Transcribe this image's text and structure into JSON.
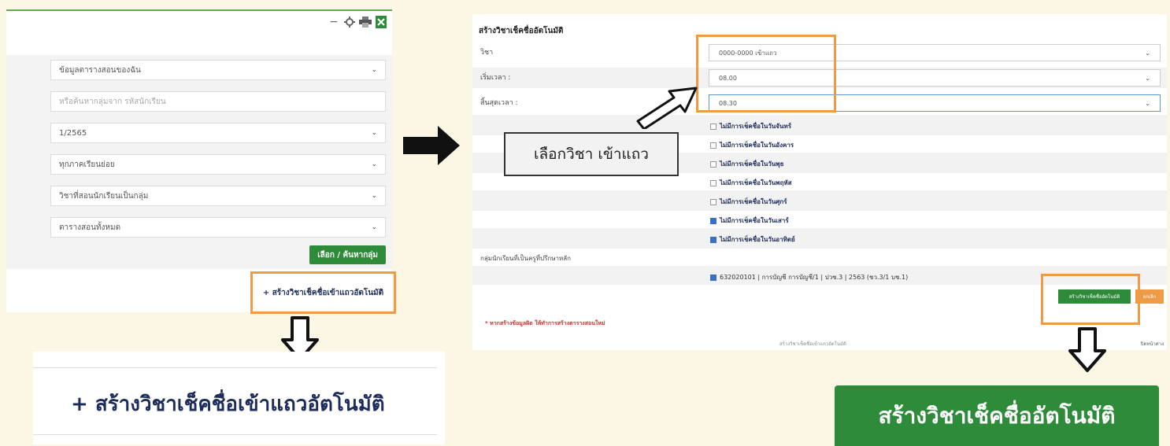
{
  "left": {
    "fields": [
      {
        "text": "ข้อมูลตารางสอนของฉัน",
        "type": "select"
      },
      {
        "text": "หรือค้นหากลุ่มจาก รหัสนักเรียน",
        "type": "input"
      },
      {
        "text": "1/2565",
        "type": "select"
      },
      {
        "text": "ทุกภาคเรียนย่อย",
        "type": "select"
      },
      {
        "text": "วิชาที่สอนนักเรียนเป็นกลุ่ม",
        "type": "select"
      },
      {
        "text": "ตารางสอนทั้งหมด",
        "type": "select"
      }
    ],
    "select_button": "เลือก / ค้นหากลุ่ม",
    "create_link": "+ สร้างวิชาเช็คชื่อเข้าแถวอัตโนมัติ"
  },
  "zoom_left_text": "+ สร้างวิชาเช็คชื่อเข้าแถวอัตโนมัติ",
  "right": {
    "header": "สร้างวิชาเช็คชื่ออัตโนมัติ",
    "rows": [
      {
        "label": "วิชา",
        "value": "0000-0000 เข้าแถว"
      },
      {
        "label": "เริ่มเวลา :",
        "value": "08.00"
      },
      {
        "label": "สิ้นสุดเวลา :",
        "value": "08.30"
      }
    ],
    "checks": [
      {
        "text": "ไม่มีการเช็คชื่อในวันจันทร์",
        "checked": false
      },
      {
        "text": "ไม่มีการเช็คชื่อในวันอังคาร",
        "checked": false
      },
      {
        "text": "ไม่มีการเช็คชื่อในวันพุธ",
        "checked": false
      },
      {
        "text": "ไม่มีการเช็คชื่อในวันพฤหัส",
        "checked": false
      },
      {
        "text": "ไม่มีการเช็คชื่อในวันศุกร์",
        "checked": false
      },
      {
        "text": "ไม่มีการเช็คชื่อในวันเสาร์",
        "checked": true
      },
      {
        "text": "ไม่มีการเช็คชื่อในวันอาทิตย์",
        "checked": true
      }
    ],
    "group_label": "กลุ่มนักเรียนที่เป็นครูที่ปรึกษาหลัก",
    "student_group": "632020101 | การบัญชี การบัญชี/1 | ปวช.3 | 2563 (ชว.3/1 บช.1)",
    "create_button": "สร้างวิชาเช็คชื่ออัตโนมัติ",
    "cancel_button": "ยกเลิก",
    "warning": "* หากสร้างข้อมูลผิด ให้ทำการสร้างตารางสอนใหม่",
    "footer_text": "สร้างวิชาเช็คชื่อเข้าแถวอัตโนมัติ",
    "footer_close": "ปิดหน้าต่าง"
  },
  "note": "เลือกวิชา เข้าแถว",
  "zoom_right_text": "สร้างวิชาเช็คชื่ออัตโนมัติ",
  "colors": {
    "accent_green": "#2e8b3a",
    "highlight_orange": "#ef9a44",
    "background": "#fcf6e4"
  },
  "icons": [
    "minus-icon",
    "settings-icon",
    "print-icon",
    "excel-icon",
    "chevron-down-icon",
    "arrow-right-icon",
    "arrow-down-icon",
    "diagonal-arrow-icon"
  ]
}
